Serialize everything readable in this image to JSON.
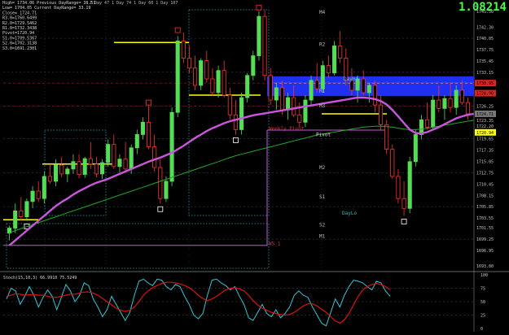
{
  "header": {
    "info_lines": [
      "High= 1734.06 Previous DayRange= 38.51",
      "Low= 1704.05 Current DayRange= 33.19",
      "Close= 1724.71",
      "R3.0=1760.6499",
      "R2.0=1729.5462",
      "R1.0=1732.3438",
      "Pivot=1720.94",
      "S1.0=1709.5367",
      "S2.0=1702.3138",
      "S3.0=1691.2301"
    ],
    "top_ticker": "1 Day   47   1 Day   74   1 Day   60   1 Day   107",
    "big_price": "1.08214"
  },
  "colors": {
    "background": "#000000",
    "bull": "#55dd55",
    "bear": "#ff3333",
    "ma_fast": "#cc55dd",
    "ma_slow": "#22aa22",
    "pivot_box": "#2233ff",
    "yellow_levels": "#ffff00",
    "stoch_k": "#2ec8d8",
    "stoch_d": "#dd1111",
    "big_price": "#44ff44"
  },
  "chart_data": [
    {
      "type": "line",
      "title": "",
      "y_axis_ticks": [
        "1745.50",
        "1742.30",
        "1740.05",
        "1737.75",
        "1735.45",
        "1733.15",
        "1730.85",
        "1728.55",
        "1726.25",
        "1723.35",
        "1722.20",
        "1719.65",
        "1717.35",
        "1715.05",
        "1712.75",
        "1710.45",
        "1708.15",
        "1705.85",
        "1703.55",
        "1701.55",
        "1699.25",
        "1696.95",
        "1693.80"
      ],
      "highlighted_prices": [
        {
          "price": "1730.95",
          "color": "#dd2222"
        },
        {
          "price": "1728.90",
          "color": "#dd2222"
        },
        {
          "price": "1724.71",
          "color": "#777777"
        },
        {
          "price": "1720.94",
          "color": "#ffff00"
        }
      ],
      "ylim": [
        1693.0,
        1746.5
      ],
      "candles": [
        [
          1700.5,
          1702.0,
          1699.0,
          1701.5
        ],
        [
          1701.5,
          1706.5,
          1700.5,
          1705.0
        ],
        [
          1705.0,
          1707.8,
          1703.0,
          1703.8
        ],
        [
          1703.8,
          1707.5,
          1703.0,
          1706.9
        ],
        [
          1706.9,
          1710.0,
          1705.5,
          1709.0
        ],
        [
          1709.0,
          1711.0,
          1706.8,
          1707.5
        ],
        [
          1707.5,
          1713.0,
          1706.5,
          1712.0
        ],
        [
          1712.0,
          1714.5,
          1710.5,
          1711.0
        ],
        [
          1711.0,
          1715.5,
          1710.0,
          1714.3
        ],
        [
          1714.3,
          1716.0,
          1711.8,
          1712.5
        ],
        [
          1712.5,
          1714.0,
          1710.8,
          1713.5
        ],
        [
          1713.5,
          1716.5,
          1712.5,
          1715.0
        ],
        [
          1715.0,
          1716.5,
          1711.6,
          1712.4
        ],
        [
          1712.4,
          1716.0,
          1711.7,
          1715.6
        ],
        [
          1715.6,
          1719.0,
          1713.5,
          1714.5
        ],
        [
          1714.5,
          1716.0,
          1711.8,
          1712.5
        ],
        [
          1712.5,
          1715.5,
          1711.5,
          1714.8
        ],
        [
          1714.8,
          1719.5,
          1714.0,
          1718.5
        ],
        [
          1718.5,
          1720.5,
          1713.5,
          1714.0
        ],
        [
          1714.0,
          1716.5,
          1712.8,
          1715.5
        ],
        [
          1715.5,
          1719.0,
          1713.0,
          1713.5
        ],
        [
          1713.5,
          1718.5,
          1712.5,
          1717.8
        ],
        [
          1717.8,
          1721.5,
          1716.5,
          1720.5
        ],
        [
          1720.5,
          1724.0,
          1719.5,
          1723.0
        ],
        [
          1723.0,
          1726.5,
          1717.5,
          1718.0
        ],
        [
          1718.0,
          1720.5,
          1713.0,
          1713.8
        ],
        [
          1713.8,
          1715.5,
          1706.5,
          1707.5
        ],
        [
          1707.5,
          1712.0,
          1706.8,
          1711.0
        ],
        [
          1711.0,
          1726.0,
          1710.0,
          1725.0
        ],
        [
          1725.0,
          1740.5,
          1724.0,
          1739.5
        ],
        [
          1739.5,
          1741.2,
          1735.0,
          1736.0
        ],
        [
          1736.0,
          1738.5,
          1733.0,
          1734.0
        ],
        [
          1734.0,
          1736.5,
          1729.5,
          1730.5
        ],
        [
          1730.5,
          1736.0,
          1729.5,
          1735.5
        ],
        [
          1735.5,
          1737.5,
          1731.0,
          1731.8
        ],
        [
          1731.8,
          1734.0,
          1728.5,
          1729.0
        ],
        [
          1729.0,
          1734.5,
          1728.0,
          1733.5
        ],
        [
          1733.5,
          1735.5,
          1728.0,
          1728.5
        ],
        [
          1728.5,
          1730.0,
          1723.5,
          1724.5
        ],
        [
          1724.5,
          1727.5,
          1720.5,
          1721.5
        ],
        [
          1721.5,
          1729.0,
          1720.5,
          1728.0
        ],
        [
          1728.0,
          1733.0,
          1727.0,
          1732.5
        ],
        [
          1732.5,
          1737.5,
          1731.5,
          1736.5
        ],
        [
          1736.5,
          1745.5,
          1735.5,
          1744.5
        ],
        [
          1744.5,
          1745.8,
          1731.5,
          1732.5
        ],
        [
          1732.5,
          1734.0,
          1726.5,
          1727.5
        ],
        [
          1727.5,
          1731.0,
          1725.5,
          1730.0
        ],
        [
          1730.0,
          1731.5,
          1724.5,
          1725.5
        ],
        [
          1725.5,
          1729.0,
          1723.5,
          1728.0
        ],
        [
          1728.0,
          1730.5,
          1724.0,
          1724.5
        ],
        [
          1724.5,
          1727.0,
          1722.0,
          1723.0
        ],
        [
          1723.0,
          1728.5,
          1722.0,
          1727.5
        ],
        [
          1727.5,
          1732.5,
          1726.5,
          1731.5
        ],
        [
          1731.5,
          1735.0,
          1729.0,
          1729.8
        ],
        [
          1729.8,
          1735.5,
          1729.0,
          1734.5
        ],
        [
          1734.5,
          1736.5,
          1732.0,
          1733.0
        ],
        [
          1733.0,
          1739.5,
          1732.5,
          1738.5
        ],
        [
          1738.5,
          1741.5,
          1735.0,
          1736.0
        ],
        [
          1736.0,
          1738.0,
          1730.5,
          1731.5
        ],
        [
          1731.5,
          1734.0,
          1728.5,
          1729.5
        ],
        [
          1729.5,
          1732.5,
          1727.0,
          1731.8
        ],
        [
          1731.8,
          1733.5,
          1728.5,
          1729.0
        ],
        [
          1729.0,
          1731.0,
          1727.0,
          1730.5
        ],
        [
          1730.5,
          1731.5,
          1725.0,
          1726.5
        ],
        [
          1726.5,
          1728.5,
          1721.5,
          1722.5
        ],
        [
          1722.5,
          1723.5,
          1716.5,
          1717.5
        ],
        [
          1717.5,
          1718.5,
          1711.5,
          1712.0
        ],
        [
          1712.0,
          1713.5,
          1706.5,
          1707.5
        ],
        [
          1707.5,
          1711.0,
          1704.0,
          1705.5
        ],
        [
          1705.5,
          1716.0,
          1704.5,
          1715.0
        ],
        [
          1715.0,
          1721.5,
          1714.0,
          1720.5
        ],
        [
          1720.5,
          1724.5,
          1719.5,
          1723.5
        ],
        [
          1723.5,
          1727.0,
          1721.5,
          1722.0
        ],
        [
          1722.0,
          1728.5,
          1721.5,
          1727.5
        ],
        [
          1727.5,
          1730.5,
          1725.0,
          1725.8
        ],
        [
          1725.8,
          1728.5,
          1723.5,
          1727.8
        ],
        [
          1727.8,
          1731.0,
          1725.0,
          1726.0
        ],
        [
          1726.0,
          1730.5,
          1724.5,
          1729.5
        ],
        [
          1729.5,
          1731.5,
          1726.5,
          1727.0
        ],
        [
          1727.0,
          1728.0,
          1723.5,
          1724.7
        ]
      ],
      "ma_fast": [
        1698.0,
        1699.0,
        1700.0,
        1701.0,
        1702.0,
        1703.0,
        1704.0,
        1705.0,
        1706.0,
        1706.8,
        1707.5,
        1708.3,
        1709.0,
        1709.6,
        1710.2,
        1710.7,
        1711.1,
        1711.5,
        1712.0,
        1712.5,
        1713.0,
        1713.5,
        1714.0,
        1714.5,
        1715.0,
        1715.4,
        1715.8,
        1716.3,
        1716.8,
        1717.5,
        1718.2,
        1719.0,
        1719.8,
        1720.5,
        1721.2,
        1721.8,
        1722.3,
        1722.8,
        1723.2,
        1723.5,
        1723.8,
        1724.1,
        1724.4,
        1724.6,
        1724.8,
        1725.0,
        1725.2,
        1725.4,
        1725.6,
        1725.8,
        1726.0,
        1726.2,
        1726.4,
        1726.6,
        1726.8,
        1727.0,
        1727.2,
        1727.4,
        1727.6,
        1727.8,
        1728.0,
        1728.0,
        1727.9,
        1727.7,
        1727.3,
        1726.6,
        1725.5,
        1724.2,
        1722.8,
        1721.5,
        1720.8,
        1720.7,
        1721.0,
        1721.5,
        1722.0,
        1722.6,
        1723.2,
        1723.8,
        1724.2,
        1724.5,
        1724.7
      ],
      "ma_slow": [
        1700.5,
        1701.0,
        1701.4,
        1701.8,
        1702.2,
        1702.6,
        1703.0,
        1703.4,
        1703.8,
        1704.2,
        1704.6,
        1705.0,
        1705.4,
        1705.8,
        1706.2,
        1706.6,
        1707.0,
        1707.4,
        1707.8,
        1708.2,
        1708.6,
        1709.0,
        1709.4,
        1709.8,
        1710.2,
        1710.6,
        1711.0,
        1711.4,
        1711.8,
        1712.2,
        1712.6,
        1713.0,
        1713.4,
        1713.8,
        1714.2,
        1714.6,
        1715.0,
        1715.4,
        1715.8,
        1716.2,
        1716.5,
        1716.8,
        1717.1,
        1717.4,
        1717.7,
        1718.0,
        1718.3,
        1718.6,
        1718.9,
        1719.2,
        1719.5,
        1719.8,
        1720.1,
        1720.4,
        1720.6,
        1720.8,
        1721.0,
        1721.2,
        1721.4,
        1721.6,
        1721.8,
        1722.0,
        1722.1,
        1722.2,
        1722.2,
        1722.1,
        1722.0,
        1721.8,
        1721.6,
        1721.5,
        1721.5,
        1721.6,
        1721.8,
        1722.0,
        1722.2,
        1722.4,
        1722.6,
        1722.8,
        1723.0,
        1723.2,
        1723.4
      ],
      "levels_right": [
        {
          "label": "M4",
          "price": 1745.0,
          "color": "#bbbbbb"
        },
        {
          "label": "R2",
          "price": 1738.5,
          "color": "#bbbbbb"
        },
        {
          "label": "R1",
          "price": 1729.0,
          "color": "#bbbbbb"
        },
        {
          "label": "M3",
          "price": 1726.0,
          "color": "#bbbbbb"
        },
        {
          "label": "M2",
          "price": 1713.5,
          "color": "#bbbbbb"
        },
        {
          "label": "S1",
          "price": 1707.5,
          "color": "#bbbbbb"
        },
        {
          "label": "S2",
          "price": 1701.8,
          "color": "#bbbbbb"
        },
        {
          "label": "M1",
          "price": 1699.5,
          "color": "#bbbbbb"
        }
      ],
      "box_labels": [
        {
          "text": "DayHi",
          "price": 1731.5,
          "color": "#55ccff"
        },
        {
          "text": "DayLo",
          "price": 1704.2,
          "color": "#33bbbb"
        },
        {
          "text": "Weekly Pivot",
          "price": 1721.4,
          "color": "#dd3333"
        },
        {
          "text": "WS 1",
          "price": 1698.0,
          "color": "#dd3333"
        },
        {
          "text": "Pivot",
          "price": 1720.2,
          "color": "#dddddd"
        }
      ]
    },
    {
      "type": "line",
      "title": "Stoch(15,10,3) 66.9910 75.5249",
      "ylim": [
        0,
        100
      ],
      "y_axis_ticks": [
        "100",
        "75",
        "50",
        "25",
        "0"
      ],
      "series": [
        {
          "name": "",
          "values": [
            55,
            75,
            70,
            45,
            60,
            78,
            62,
            40,
            58,
            72,
            60,
            35,
            58,
            82,
            70,
            50,
            62,
            85,
            80,
            55,
            40,
            22,
            35,
            60,
            45,
            30,
            15,
            30,
            62,
            88,
            92,
            85,
            80,
            92,
            90,
            78,
            72,
            82,
            78,
            60,
            45,
            25,
            18,
            28,
            62,
            90,
            92,
            85,
            80,
            72,
            78,
            60,
            45,
            20,
            15,
            30,
            45,
            28,
            22,
            35,
            20,
            28,
            40,
            62,
            70,
            62,
            58,
            40,
            25,
            10,
            5,
            30,
            55,
            40,
            62,
            78,
            90,
            88,
            85,
            78,
            72,
            88,
            85,
            70,
            60
          ]
        },
        {
          "name": "",
          "values": [
            60,
            62,
            65,
            64,
            62,
            63,
            63,
            62,
            62,
            60,
            58,
            58,
            60,
            62,
            64,
            64,
            66,
            68,
            68,
            66,
            62,
            56,
            50,
            44,
            38,
            34,
            32,
            34,
            40,
            50,
            62,
            70,
            76,
            80,
            84,
            86,
            86,
            85,
            83,
            80,
            76,
            70,
            62,
            56,
            52,
            55,
            60,
            66,
            72,
            75,
            76,
            74,
            70,
            62,
            52,
            44,
            38,
            34,
            30,
            28,
            26,
            25,
            26,
            30,
            36,
            42,
            46,
            46,
            42,
            36,
            30,
            22,
            14,
            10,
            16,
            28,
            44,
            60,
            72,
            78,
            82,
            84,
            82,
            78,
            72
          ]
        }
      ]
    }
  ]
}
